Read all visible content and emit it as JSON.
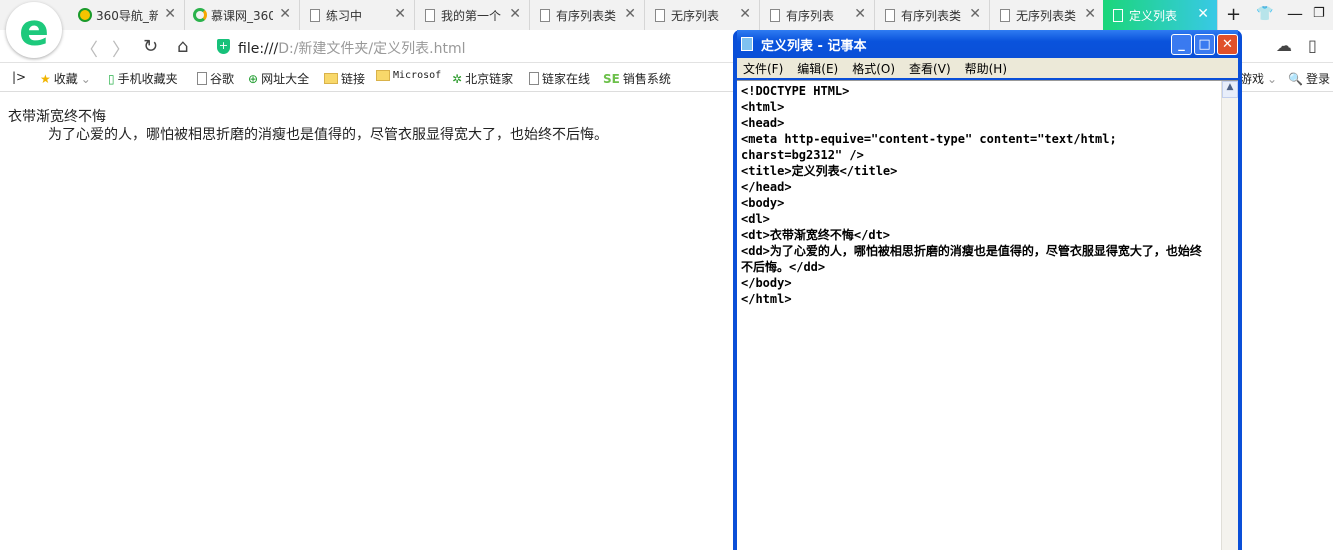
{
  "tabs": [
    {
      "label": "360导航_新",
      "icon": "360-icon"
    },
    {
      "label": "慕课网_360",
      "icon": "imooc-icon"
    },
    {
      "label": "练习中",
      "icon": "page-icon"
    },
    {
      "label": "我的第一个",
      "icon": "page-icon"
    },
    {
      "label": "有序列表类",
      "icon": "page-icon"
    },
    {
      "label": "无序列表",
      "icon": "page-icon"
    },
    {
      "label": "有序列表",
      "icon": "page-icon"
    },
    {
      "label": "有序列表类",
      "icon": "page-icon"
    },
    {
      "label": "无序列表类",
      "icon": "page-icon"
    },
    {
      "label": "定义列表",
      "icon": "page-icon"
    }
  ],
  "address": {
    "scheme": "file:///",
    "path": "D:/新建文件夹/定义列表.html"
  },
  "bookmarks": [
    "收藏",
    "手机收藏夹",
    "谷歌",
    "网址大全",
    "链接",
    "Microsof",
    "北京链家",
    "链家在线",
    "销售系统"
  ],
  "bookmarks_right": [
    "游戏",
    "登录"
  ],
  "page": {
    "dt": "衣带渐宽终不悔",
    "dd": "为了心爱的人，哪怕被相思折磨的消瘦也是值得的，尽管衣服显得宽大了，也始终不后悔。"
  },
  "notepad": {
    "title": "定义列表 - 记事本",
    "menu": [
      "文件(F)",
      "编辑(E)",
      "格式(O)",
      "查看(V)",
      "帮助(H)"
    ],
    "text": "<!DOCTYPE HTML>\n<html>\n<head>\n<meta http-equive=\"content-type\" content=\"text/html; charst=bg2312\" />\n<title>定义列表</title>\n</head>\n<body>\n<dl>\n<dt>衣带渐宽终不悔</dt>\n<dd>为了心爱的人，哪怕被相思折磨的消瘦也是值得的，尽管衣服显得宽大了，也始终不后悔。</dd>\n</body>\n</html>"
  }
}
